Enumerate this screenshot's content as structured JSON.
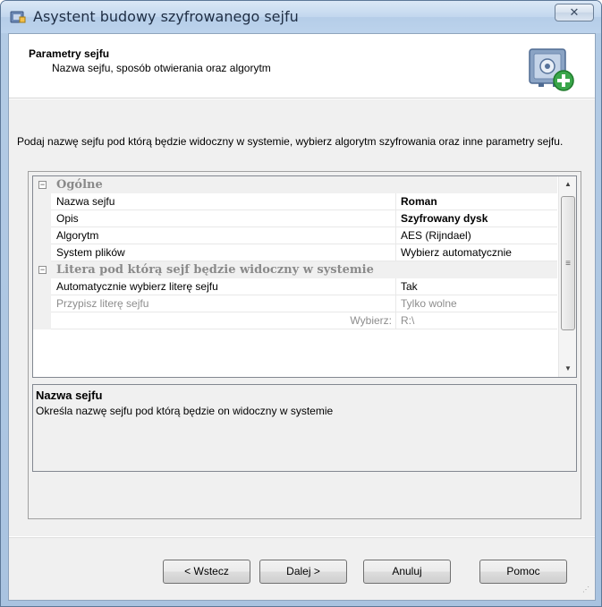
{
  "window": {
    "title": "Asystent budowy szyfrowanego sejfu",
    "close_glyph": "✕"
  },
  "header": {
    "title": "Parametry sejfu",
    "subtitle": "Nazwa sejfu, sposób otwierania oraz algorytm",
    "icon": "safe-add-icon"
  },
  "instructions": "Podaj nazwę sejfu pod którą będzie widoczny w systemie, wybierz algorytm szyfrowania oraz inne parametry sejfu.",
  "property_grid": {
    "categories": [
      {
        "label": "Ogólne",
        "expanded": true,
        "properties": [
          {
            "name": "Nazwa sejfu",
            "value": "Roman"
          },
          {
            "name": "Opis",
            "value": "Szyfrowany dysk"
          },
          {
            "name": "Algorytm",
            "value": "AES (Rijndael)"
          },
          {
            "name": "System plików",
            "value": "Wybierz automatycznie"
          }
        ]
      },
      {
        "label": "Litera pod którą sejf będzie widoczny w systemie",
        "expanded": true,
        "properties": [
          {
            "name": "Automatycznie wybierz literę sejfu",
            "value": "Tak"
          },
          {
            "name": "Przypisz literę sejfu",
            "value": "Tylko wolne"
          },
          {
            "name": "Wybierz:",
            "value": "R:\\"
          }
        ]
      }
    ],
    "expander_glyph": "−",
    "scroll_up": "▲",
    "scroll_down": "▼",
    "thumb_grip": "≡"
  },
  "description": {
    "title": "Nazwa sejfu",
    "text": "Określa nazwę sejfu pod którą będzie on widoczny w systemie"
  },
  "buttons": {
    "back": "< Wstecz",
    "next": "Dalej >",
    "cancel": "Anuluj",
    "help": "Pomoc"
  },
  "colors": {
    "titlebar": "#c2d7ee",
    "category_text": "#8a8a8a",
    "disabled_text": "#8d8d8d"
  }
}
